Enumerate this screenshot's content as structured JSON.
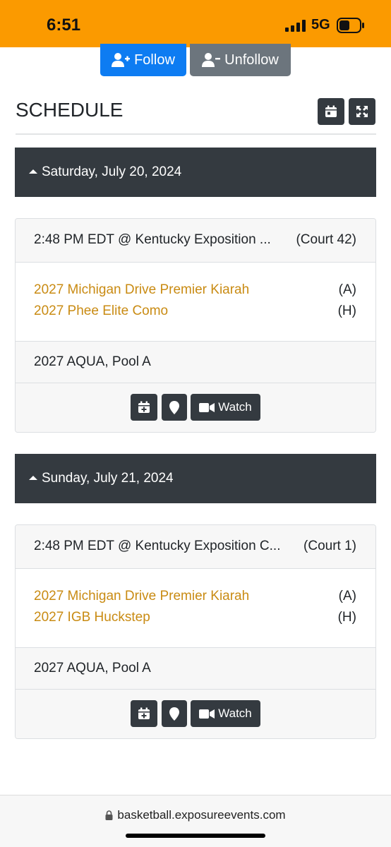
{
  "status_bar": {
    "time": "6:51",
    "network": "5G"
  },
  "actions": {
    "follow_label": "Follow",
    "unfollow_label": "Unfollow"
  },
  "schedule": {
    "title": "SCHEDULE",
    "days": [
      {
        "date": "Saturday, July 20, 2024",
        "game": {
          "location": "2:48 PM EDT @ Kentucky Exposition ...",
          "court": "(Court 42)",
          "teams": [
            {
              "name": "2027 Michigan Drive Premier Kiarah",
              "side": "(A)"
            },
            {
              "name": "2027 Phee Elite Como",
              "side": "(H)"
            }
          ],
          "pool": "2027 AQUA, Pool A",
          "watch_label": "Watch"
        }
      },
      {
        "date": "Sunday, July 21, 2024",
        "game": {
          "location": "2:48 PM EDT @ Kentucky Exposition C...",
          "court": "(Court 1)",
          "teams": [
            {
              "name": "2027 Michigan Drive Premier Kiarah",
              "side": "(A)"
            },
            {
              "name": "2027 IGB Huckstep",
              "side": "(H)"
            }
          ],
          "pool": "2027 AQUA, Pool A",
          "watch_label": "Watch"
        }
      }
    ]
  },
  "browser": {
    "url": "basketball.exposureevents.com"
  },
  "colors": {
    "status_bar": "#fb9a00",
    "follow": "#0d7cf2",
    "unfollow": "#6c757d",
    "dark": "#343a40",
    "team_link": "#c98b13"
  },
  "icons": [
    "user-plus-icon",
    "user-minus-icon",
    "calendar-icon",
    "expand-icon",
    "calendar-plus-icon",
    "map-marker-icon",
    "video-icon",
    "lock-icon"
  ]
}
